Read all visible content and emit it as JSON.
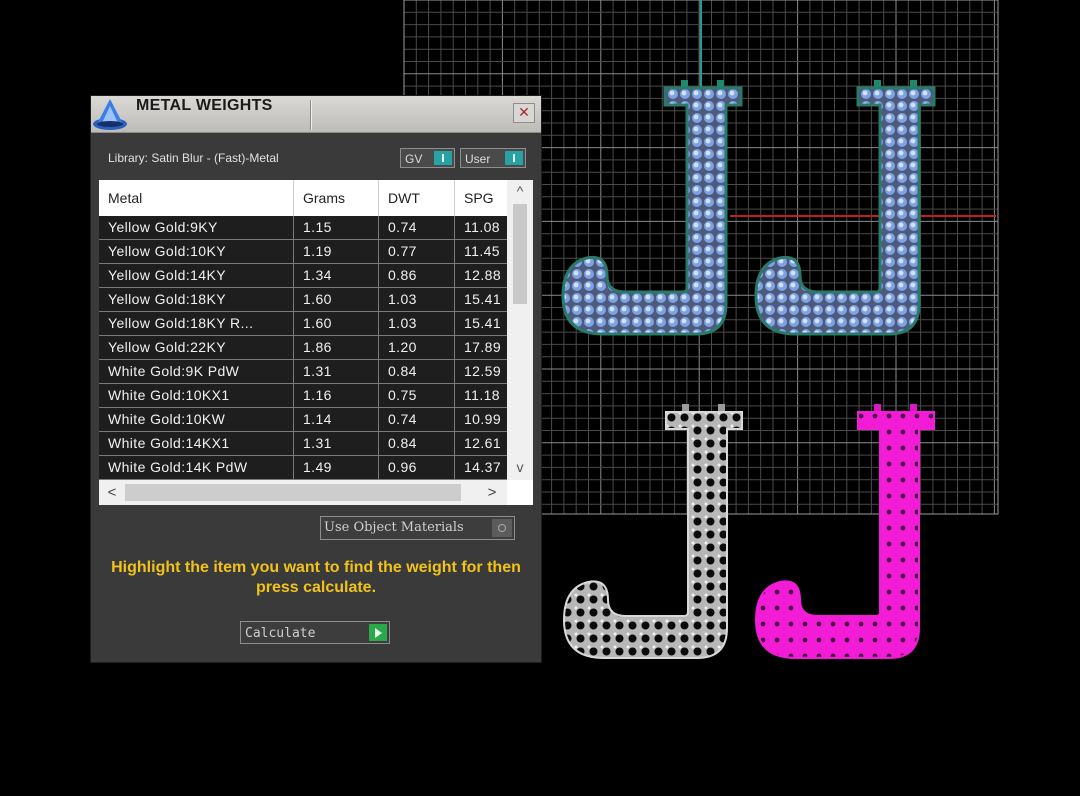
{
  "panel": {
    "title": "METAL WEIGHTS",
    "close_glyph": "✕",
    "library_label": "Library: Satin Blur - (Fast)-Metal",
    "toggles": {
      "gv": "GV",
      "user": "User"
    },
    "table": {
      "headers": [
        "Metal",
        "Grams",
        "DWT",
        "SPG"
      ],
      "rows": [
        [
          "Yellow Gold:9KY",
          "1.15",
          "0.74",
          "11.08"
        ],
        [
          "Yellow Gold:10KY",
          "1.19",
          "0.77",
          "11.45"
        ],
        [
          "Yellow Gold:14KY",
          "1.34",
          "0.86",
          "12.88"
        ],
        [
          "Yellow Gold:18KY",
          "1.60",
          "1.03",
          "15.41"
        ],
        [
          "Yellow Gold:18KY R...",
          "1.60",
          "1.03",
          "15.41"
        ],
        [
          "Yellow Gold:22KY",
          "1.86",
          "1.20",
          "17.89"
        ],
        [
          "White Gold:9K PdW",
          "1.31",
          "0.84",
          "12.59"
        ],
        [
          "White Gold:10KX1",
          "1.16",
          "0.75",
          "11.18"
        ],
        [
          "White Gold:10KW",
          "1.14",
          "0.74",
          "10.99"
        ],
        [
          "White Gold:14KX1",
          "1.31",
          "0.84",
          "12.61"
        ],
        [
          "White Gold:14K PdW",
          "1.49",
          "0.96",
          "14.37"
        ]
      ],
      "scroll_up": "^",
      "scroll_down": "v",
      "scroll_left": "<",
      "scroll_right": ">"
    },
    "use_object_materials": "Use Object Materials",
    "hint": "Highlight the item you want to find the weight for then press calculate.",
    "calculate_label": "Calculate"
  },
  "scene": {
    "colors": {
      "grid": "#6f6f6f",
      "stone_blue": "#8fb2ee",
      "metal_silver": "#c9c9c9",
      "metal_pink": "#f21cd6",
      "axis_red": "#c0201c",
      "axis_teal": "#1e9e98"
    }
  }
}
